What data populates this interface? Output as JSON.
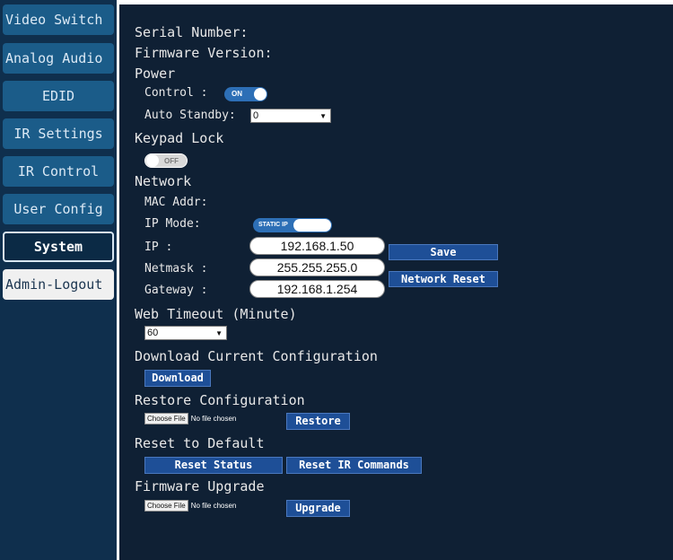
{
  "sidebar": {
    "items": [
      {
        "label": "Video Switch"
      },
      {
        "label": "Analog Audio"
      },
      {
        "label": "EDID"
      },
      {
        "label": "IR Settings"
      },
      {
        "label": "IR Control"
      },
      {
        "label": "User Config"
      },
      {
        "label": "System",
        "active": true
      },
      {
        "label": "Admin-Logout"
      }
    ]
  },
  "system": {
    "serial_number_label": "Serial Number:",
    "firmware_version_label": "Firmware Version:",
    "power": {
      "heading": "Power",
      "control_label": "Control :",
      "control_toggle": "ON",
      "auto_standby_label": "Auto Standby:",
      "auto_standby_value": "0"
    },
    "keypad_lock": {
      "heading": "Keypad Lock",
      "toggle": "OFF"
    },
    "network": {
      "heading": "Network",
      "mac_label": "MAC Addr:",
      "ip_mode_label": "IP Mode:",
      "ip_mode_toggle": "STATIC IP",
      "ip_label": "IP :",
      "ip_value": "192.168.1.50",
      "netmask_label": "Netmask :",
      "netmask_value": "255.255.255.0",
      "gateway_label": "Gateway :",
      "gateway_value": "192.168.1.254",
      "save_label": "Save",
      "network_reset_label": "Network Reset"
    },
    "web_timeout": {
      "heading": "Web Timeout (Minute)",
      "value": "60"
    },
    "download": {
      "heading": "Download Current Configuration",
      "button_label": "Download"
    },
    "restore": {
      "heading": "Restore Configuration",
      "choose_file_label": "Choose File",
      "no_file_text": "No file chosen",
      "button_label": "Restore"
    },
    "reset": {
      "heading": "Reset to Default",
      "reset_status_label": "Reset Status",
      "reset_ir_label": "Reset IR Commands"
    },
    "firmware": {
      "heading": "Firmware Upgrade",
      "choose_file_label": "Choose File",
      "no_file_text": "No file chosen",
      "button_label": "Upgrade"
    }
  },
  "colors": {
    "sidebar_bg": "#0f2f4d",
    "nav_button": "#1b5c89",
    "main_bg": "#0f2034",
    "action_button": "#1e4f97",
    "toggle_on": "#2d6fb6",
    "toggle_off": "#d9d9d9"
  }
}
